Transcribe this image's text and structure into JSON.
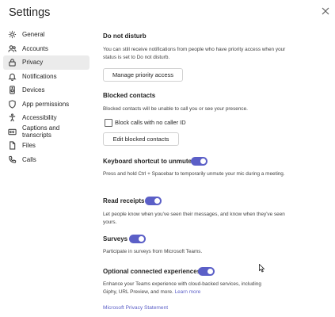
{
  "window": {
    "title": "Settings"
  },
  "sidebar": {
    "items": [
      {
        "label": "General",
        "icon": "gear-icon"
      },
      {
        "label": "Accounts",
        "icon": "accounts-icon"
      },
      {
        "label": "Privacy",
        "icon": "lock-icon",
        "active": true
      },
      {
        "label": "Notifications",
        "icon": "bell-icon"
      },
      {
        "label": "Devices",
        "icon": "speaker-icon"
      },
      {
        "label": "App permissions",
        "icon": "shield-icon"
      },
      {
        "label": "Accessibility",
        "icon": "accessibility-icon"
      },
      {
        "label": "Captions and transcripts",
        "icon": "captions-icon"
      },
      {
        "label": "Files",
        "icon": "file-icon"
      },
      {
        "label": "Calls",
        "icon": "phone-icon"
      }
    ]
  },
  "privacy": {
    "dnd": {
      "heading": "Do not disturb",
      "description": "You can still receive notifications from people who have priority access when your status is set to Do not disturb.",
      "button": "Manage priority access"
    },
    "blocked": {
      "heading": "Blocked contacts",
      "description": "Blocked contacts will be unable to call you or see your presence.",
      "checkbox_label": "Block calls with no caller ID",
      "checkbox_checked": false,
      "button": "Edit blocked contacts"
    },
    "keyboard": {
      "heading": "Keyboard shortcut to unmute",
      "description": "Press and hold Ctrl + Spacebar to temporarily unmute your mic during a meeting.",
      "enabled": true
    },
    "receipts": {
      "heading": "Read receipts",
      "description": "Let people know when you've seen their messages, and know when they've seen yours.",
      "enabled": true
    },
    "surveys": {
      "heading": "Surveys",
      "description": "Participate in surveys from Microsoft Teams.",
      "enabled": true
    },
    "optional": {
      "heading": "Optional connected experiences",
      "description": "Enhance your Teams experience with cloud-backed services, including Giphy, URL Preview, and more.",
      "learn_more": "Learn more",
      "enabled": true
    },
    "statement_link": "Microsoft Privacy Statement"
  },
  "colors": {
    "accent": "#5b5fc7",
    "active_bg": "#ebebeb"
  }
}
